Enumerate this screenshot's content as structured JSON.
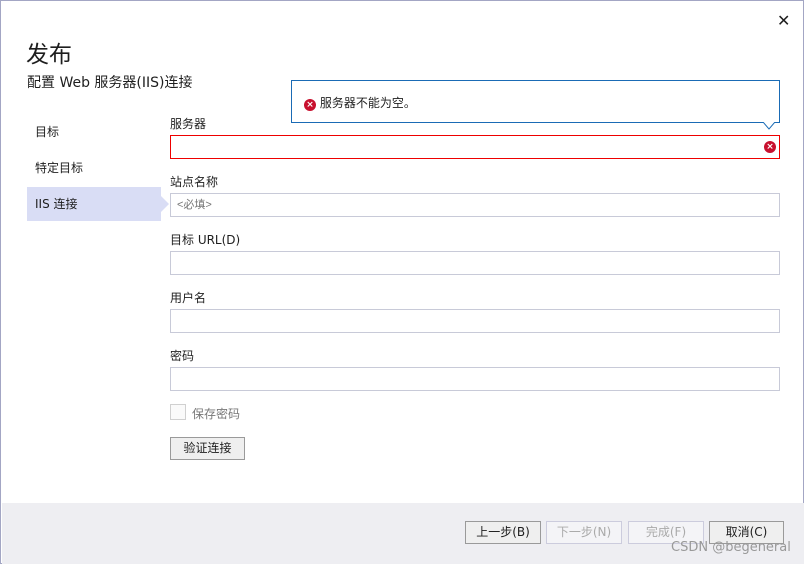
{
  "window": {
    "close": "✕",
    "title": "发布",
    "subtitle": "配置 Web 服务器(IIS)连接"
  },
  "nav": [
    {
      "label": "目标"
    },
    {
      "label": "特定目标"
    },
    {
      "label": "IIS 连接"
    }
  ],
  "error_tooltip": {
    "message": "服务器不能为空。"
  },
  "form": {
    "server_label": "服务器",
    "server_value": "",
    "site_label": "站点名称",
    "site_placeholder": "<必填>",
    "url_label": "目标 URL(D)",
    "url_value": "",
    "user_label": "用户名",
    "user_value": "",
    "password_label": "密码",
    "password_value": "",
    "save_password_label": "保存密码",
    "save_password_checked": false,
    "validate_button": "验证连接"
  },
  "footer": {
    "prev": "上一步(B)",
    "next": "下一步(N)",
    "finish": "完成(F)",
    "cancel": "取消(C)"
  },
  "watermark": "CSDN @begeneral"
}
